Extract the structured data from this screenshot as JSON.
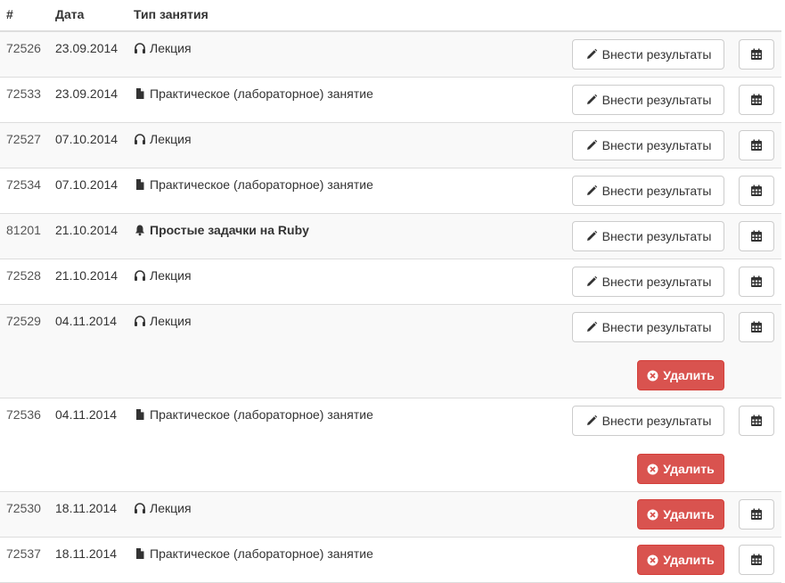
{
  "header": {
    "id": "#",
    "date": "Дата",
    "type": "Тип занятия"
  },
  "labels": {
    "results": "Внести результаты",
    "delete": "Удалить"
  },
  "icons": {
    "lecture": "headphones-icon",
    "practice": "file-icon",
    "task": "bell-icon",
    "results": "pencil-icon",
    "delete": "x-icon",
    "calendar": "calendar-icon"
  },
  "colors": {
    "danger": "#d9534f",
    "border": "#dddddd",
    "stripe": "#f9f9f9"
  },
  "rows": [
    {
      "id": "72526",
      "date": "23.09.2014",
      "type": "Лекция",
      "kind": "lecture",
      "bold": false,
      "results": true,
      "delete": false
    },
    {
      "id": "72533",
      "date": "23.09.2014",
      "type": "Практическое (лабораторное) занятие",
      "kind": "practice",
      "bold": false,
      "results": true,
      "delete": false
    },
    {
      "id": "72527",
      "date": "07.10.2014",
      "type": "Лекция",
      "kind": "lecture",
      "bold": false,
      "results": true,
      "delete": false
    },
    {
      "id": "72534",
      "date": "07.10.2014",
      "type": "Практическое (лабораторное) занятие",
      "kind": "practice",
      "bold": false,
      "results": true,
      "delete": false
    },
    {
      "id": "81201",
      "date": "21.10.2014",
      "type": "Простые задачки на Ruby",
      "kind": "task",
      "bold": true,
      "results": true,
      "delete": false
    },
    {
      "id": "72528",
      "date": "21.10.2014",
      "type": "Лекция",
      "kind": "lecture",
      "bold": false,
      "results": true,
      "delete": false
    },
    {
      "id": "72529",
      "date": "04.11.2014",
      "type": "Лекция",
      "kind": "lecture",
      "bold": false,
      "results": true,
      "delete": true
    },
    {
      "id": "72536",
      "date": "04.11.2014",
      "type": "Практическое (лабораторное) занятие",
      "kind": "practice",
      "bold": false,
      "results": true,
      "delete": true
    },
    {
      "id": "72530",
      "date": "18.11.2014",
      "type": "Лекция",
      "kind": "lecture",
      "bold": false,
      "results": false,
      "delete": true
    },
    {
      "id": "72537",
      "date": "18.11.2014",
      "type": "Практическое (лабораторное) занятие",
      "kind": "practice",
      "bold": false,
      "results": false,
      "delete": true
    }
  ]
}
